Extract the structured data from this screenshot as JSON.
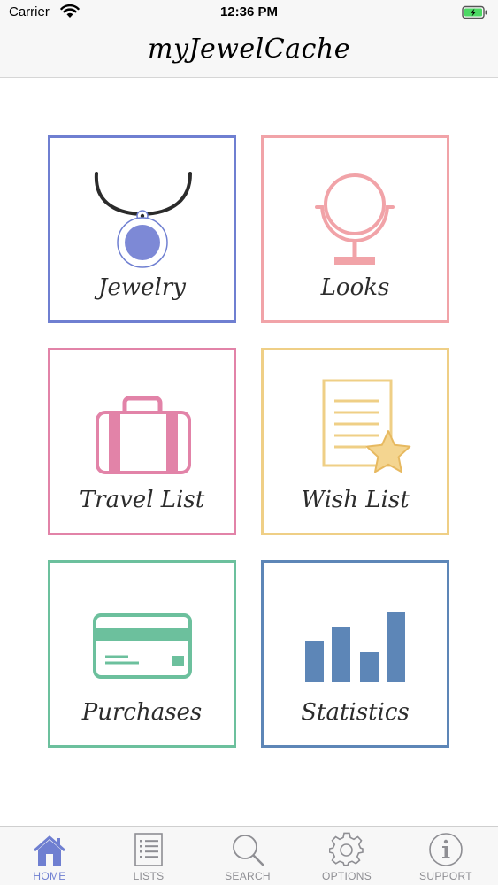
{
  "status_bar": {
    "carrier": "Carrier",
    "time": "12:36 PM"
  },
  "nav": {
    "title": "myJewelCache"
  },
  "tiles": [
    {
      "label": "Jewelry",
      "color": "#6f7fd1",
      "icon": "necklace-icon"
    },
    {
      "label": "Looks",
      "color": "#f1a3a8",
      "icon": "mirror-icon"
    },
    {
      "label": "Travel List",
      "color": "#e283a8",
      "icon": "suitcase-icon"
    },
    {
      "label": "Wish List",
      "color": "#efcf86",
      "icon": "wishlist-star-icon"
    },
    {
      "label": "Purchases",
      "color": "#6cc09d",
      "icon": "credit-card-icon"
    },
    {
      "label": "Statistics",
      "color": "#5d86b7",
      "icon": "bar-chart-icon"
    }
  ],
  "tab_bar": {
    "items": [
      {
        "label": "HOME",
        "icon": "home-icon",
        "active": true
      },
      {
        "label": "LISTS",
        "icon": "list-icon",
        "active": false
      },
      {
        "label": "SEARCH",
        "icon": "search-icon",
        "active": false
      },
      {
        "label": "OPTIONS",
        "icon": "gear-icon",
        "active": false
      },
      {
        "label": "SUPPORT",
        "icon": "info-icon",
        "active": false
      }
    ],
    "active_color": "#6f7fd1",
    "inactive_color": "#8e8e93"
  }
}
